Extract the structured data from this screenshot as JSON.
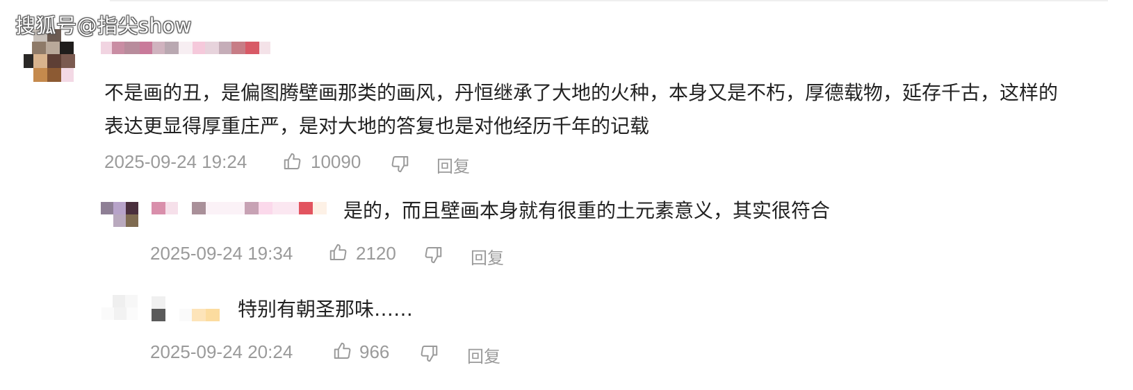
{
  "watermark": "搜狐号@指尖show",
  "comments": [
    {
      "text": "不是画的丑，是偏图腾壁画那类的画风，丹恒继承了大地的火种，本身又是不朽，厚德载物，延存千古，这样的表达更显得厚重庄严，是对大地的答复也是对他经历千年的记载",
      "timestamp": "2025-09-24 19:24",
      "likes": "10090",
      "reply_label": "回复"
    },
    {
      "text": "是的，而且壁画本身就有很重的土元素意义，其实很符合",
      "timestamp": "2025-09-24 19:34",
      "likes": "2120",
      "reply_label": "回复"
    },
    {
      "text": "特别有朝圣那味……",
      "timestamp": "2025-09-24 20:24",
      "likes": "966",
      "reply_label": "回复"
    }
  ],
  "icons": {
    "like": "thumbs-up-icon",
    "dislike": "thumbs-down-icon"
  },
  "colors": {
    "text": "#222222",
    "meta": "#9a9a9a",
    "divider": "#efefef"
  }
}
